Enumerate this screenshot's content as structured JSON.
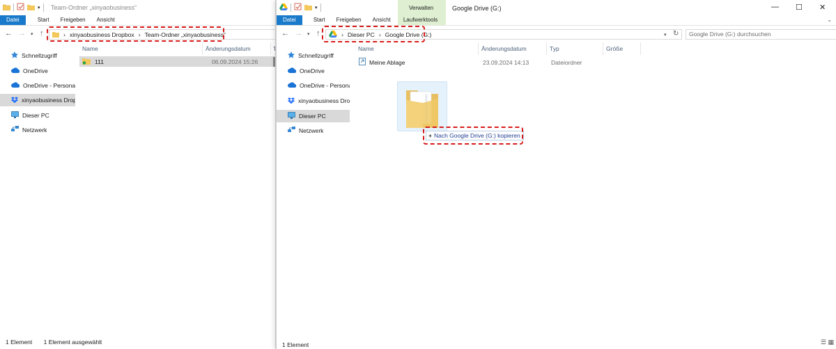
{
  "left_window": {
    "title": "Team-Ordner „xinyaobusiness“",
    "ribbon_tabs": [
      "Datei",
      "Start",
      "Freigeben",
      "Ansicht"
    ],
    "breadcrumb": [
      "xinyaobusiness Dropbox",
      "Team-Ordner „xinyaobusiness“"
    ],
    "nav_items": [
      {
        "label": "Schnellzugriff",
        "icon": "star-icon"
      },
      {
        "label": "OneDrive",
        "icon": "cloud-icon"
      },
      {
        "label": "OneDrive - Personal",
        "icon": "cloud-icon"
      },
      {
        "label": "xinyaobusiness Dropbox",
        "icon": "dropbox-icon"
      },
      {
        "label": "Dieser PC",
        "icon": "monitor-icon"
      },
      {
        "label": "Netzwerk",
        "icon": "network-icon"
      }
    ],
    "columns": {
      "name": "Name",
      "date": "Änderungsdatum",
      "type": "T"
    },
    "files": [
      {
        "name": "111",
        "date": "06.09.2024 15:26"
      }
    ],
    "status": {
      "count": "1 Element",
      "selected": "1 Element ausgewählt"
    }
  },
  "right_window": {
    "title": "Google Drive (G:)",
    "context_tab_group": "Verwalten",
    "ribbon_tabs": [
      "Datei",
      "Start",
      "Freigeben",
      "Ansicht",
      "Laufwerktools"
    ],
    "breadcrumb": [
      "Dieser PC",
      "Google Drive (G:)"
    ],
    "search_placeholder": "Google Drive (G:) durchsuchen",
    "nav_items": [
      {
        "label": "Schnellzugriff",
        "icon": "star-icon"
      },
      {
        "label": "OneDrive",
        "icon": "cloud-icon"
      },
      {
        "label": "OneDrive - Personal",
        "icon": "cloud-icon"
      },
      {
        "label": "xinyaobusiness Dropbox",
        "icon": "dropbox-icon"
      },
      {
        "label": "Dieser PC",
        "icon": "monitor-icon"
      },
      {
        "label": "Netzwerk",
        "icon": "network-icon"
      }
    ],
    "columns": {
      "name": "Name",
      "date": "Änderungsdatum",
      "type": "Typ",
      "size": "Größe"
    },
    "files": [
      {
        "name": "Meine Ablage",
        "date": "23.09.2024 14:13",
        "type": "Dateiordner"
      }
    ],
    "drag_tooltip": "Nach Google Drive (G:) kopieren",
    "status": {
      "count": "1 Element"
    }
  },
  "colors": {
    "file_tab": "#1979ca",
    "context_tab": "#dff0d2",
    "highlight": "#d71a1a",
    "selection": "#d9d9d9"
  }
}
